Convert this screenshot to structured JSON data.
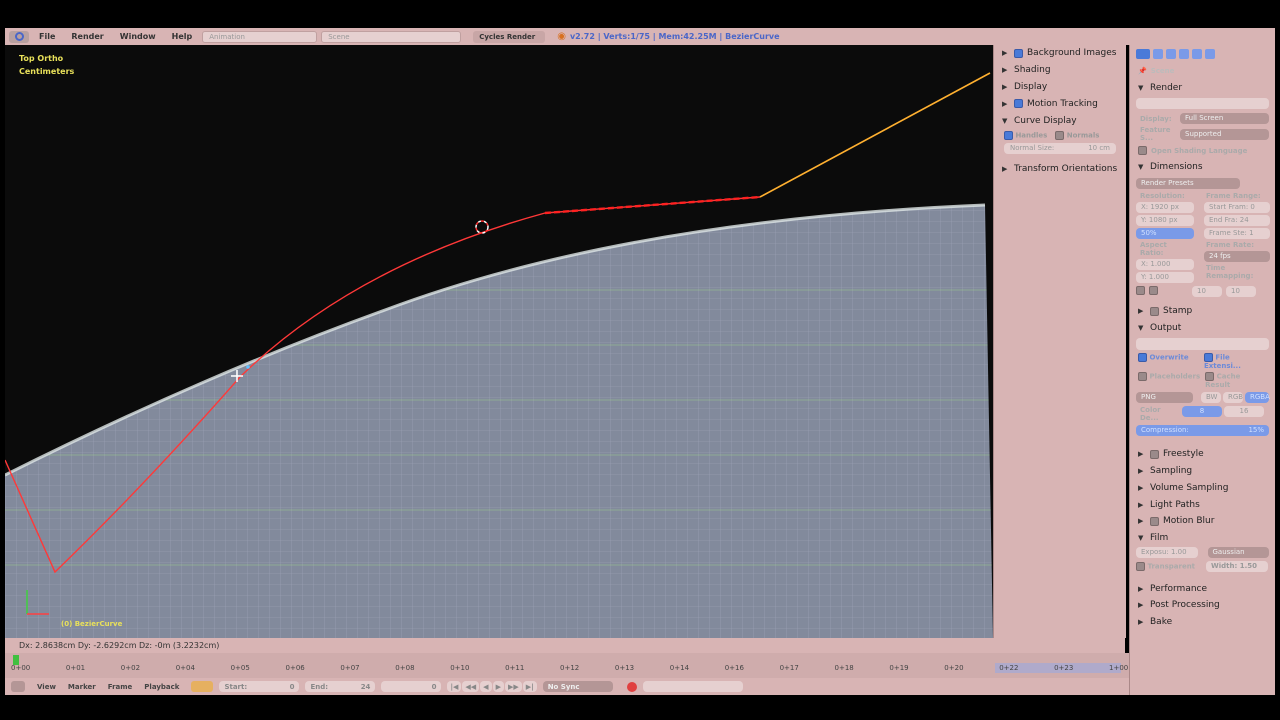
{
  "header": {
    "menus": [
      "File",
      "Render",
      "Window",
      "Help"
    ],
    "layout_field": "Animation",
    "scene_field": "Scene",
    "engine": "Cycles Render",
    "info": "v2.72 | Verts:1/75 | Mem:42.25M | BezierCurve"
  },
  "viewport": {
    "view_name": "Top Ortho",
    "units": "Centimeters",
    "object_label": "(0) BezierCurve",
    "status": "Dx: 2.8638cm   Dy: -2.6292cm  Dz: -0m (3.2232cm)"
  },
  "npanel": {
    "items": [
      {
        "label": "Background Images",
        "checkbox": true,
        "expanded": false
      },
      {
        "label": "Shading",
        "checkbox": false,
        "expanded": false
      },
      {
        "label": "Display",
        "checkbox": false,
        "expanded": false
      },
      {
        "label": "Motion Tracking",
        "checkbox": true,
        "expanded": false
      },
      {
        "label": "Curve Display",
        "checkbox": false,
        "expanded": true
      }
    ],
    "curve_display": {
      "handles": "Handles",
      "normals": "Normals",
      "normal_size": "Normal Size:",
      "normal_size_value": "10 cm"
    },
    "transform_orientations": "Transform Orientations"
  },
  "properties": {
    "context": "Scene",
    "render": {
      "title": "Render",
      "display_label": "Display:",
      "display_value": "Full Screen",
      "feature_label": "Feature S...",
      "feature_value": "Supported",
      "osl": "Open Shading Language"
    },
    "dimensions": {
      "title": "Dimensions",
      "presets": "Render Presets",
      "resolution": "Resolution:",
      "frame_range": "Frame Range:",
      "x": "X: 1920 px",
      "y": "Y: 1080 px",
      "percent": "50%",
      "start": "Start Fram: 0",
      "end": "End Fra: 24",
      "step": "Frame Ste: 1",
      "aspect": "Aspect Ratio:",
      "frame_rate": "Frame Rate:",
      "ax": "X: 1.000",
      "ay": "Y: 1.000",
      "fps": "24 fps",
      "time_remap": "Time Remapping:",
      "remap_old": "10",
      "remap_new": "10"
    },
    "stamp": "Stamp",
    "output": {
      "title": "Output",
      "overwrite": "Overwrite",
      "file_ext": "File Extensi...",
      "placeholders": "Placeholders",
      "cache_result": "Cache Result",
      "format": "PNG",
      "bw": "BW",
      "rgb": "RGB",
      "rgba": "RGBA",
      "color_depth": "Color De...",
      "depth8": "8",
      "depth16": "16",
      "compression": "Compression:",
      "compression_value": "15%"
    },
    "sections": [
      "Freestyle",
      "Sampling",
      "Volume Sampling",
      "Light Paths",
      "Motion Blur",
      "Film"
    ],
    "film": {
      "exposure": "Exposu: 1.00",
      "filter": "Gaussian",
      "transparent": "Transparent",
      "width": "Width: 1.50"
    },
    "sections2": [
      "Performance",
      "Post Processing",
      "Bake"
    ]
  },
  "timeline": {
    "ticks": [
      "0+00",
      "0+01",
      "0+02",
      "0+04",
      "0+05",
      "0+06",
      "0+07",
      "0+08",
      "0+10",
      "0+11",
      "0+12",
      "0+13",
      "0+14",
      "0+16",
      "0+17",
      "0+18",
      "0+19",
      "0+20",
      "0+22",
      "0+23",
      "1+00"
    ],
    "menus": [
      "View",
      "Marker",
      "Frame",
      "Playback"
    ],
    "start": "Start:",
    "start_value": "0",
    "end": "End:",
    "end_value": "24",
    "current": "0",
    "sync": "No Sync"
  },
  "colors": {
    "panel": "#d8b4b4",
    "accent": "#4a7ad8",
    "viewport": "#0b0b0b",
    "curve": "#ff4040",
    "handle": "#ffb030"
  }
}
